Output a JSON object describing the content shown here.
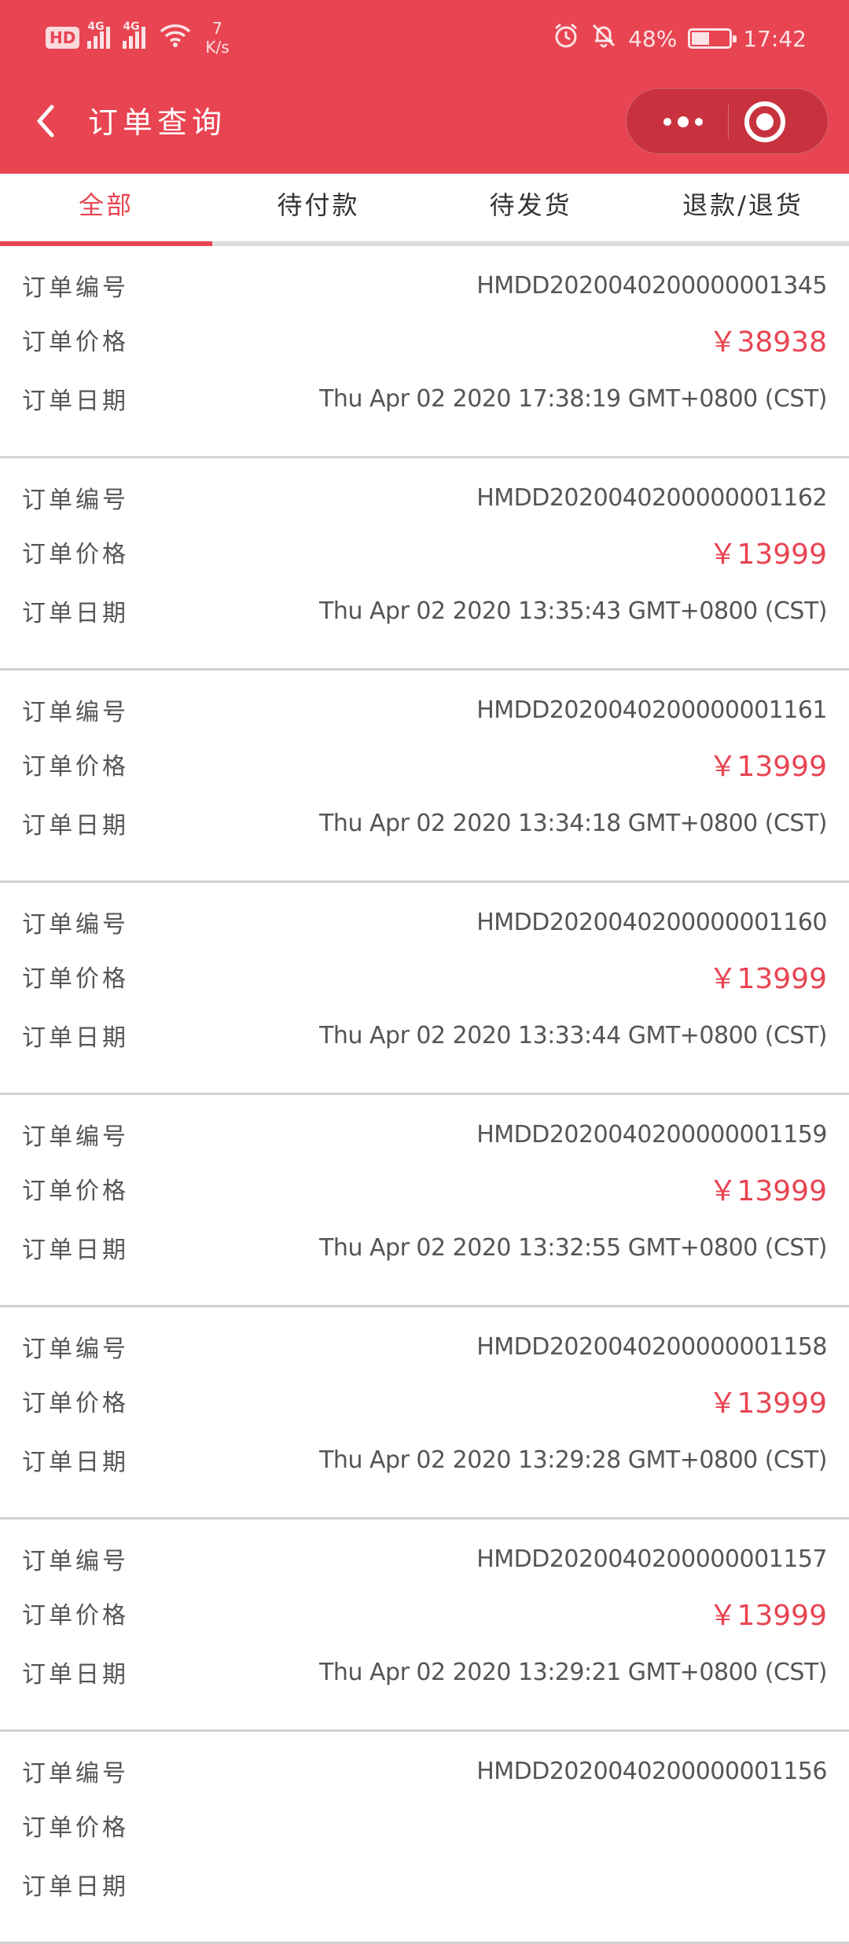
{
  "status_bar": {
    "hd": "HD",
    "net1": "4G",
    "net2": "4G",
    "speed_value": "7",
    "speed_unit": "K/s",
    "battery": "48%",
    "time": "17:42",
    "battery_level": 0.48
  },
  "nav": {
    "title": "订单查询"
  },
  "tabs": [
    {
      "label": "全部",
      "active": true
    },
    {
      "label": "待付款",
      "active": false
    },
    {
      "label": "待发货",
      "active": false
    },
    {
      "label": "退款/退货",
      "active": false
    }
  ],
  "labels": {
    "order_no": "订单编号",
    "price": "订单价格",
    "date": "订单日期"
  },
  "orders": [
    {
      "id": "HMDD2020040200000001345",
      "price": "￥38938",
      "date": "Thu Apr 02 2020 17:38:19 GMT+0800 (CST)"
    },
    {
      "id": "HMDD2020040200000001162",
      "price": "￥13999",
      "date": "Thu Apr 02 2020 13:35:43 GMT+0800 (CST)"
    },
    {
      "id": "HMDD2020040200000001161",
      "price": "￥13999",
      "date": "Thu Apr 02 2020 13:34:18 GMT+0800 (CST)"
    },
    {
      "id": "HMDD2020040200000001160",
      "price": "￥13999",
      "date": "Thu Apr 02 2020 13:33:44 GMT+0800 (CST)"
    },
    {
      "id": "HMDD2020040200000001159",
      "price": "￥13999",
      "date": "Thu Apr 02 2020 13:32:55 GMT+0800 (CST)"
    },
    {
      "id": "HMDD2020040200000001158",
      "price": "￥13999",
      "date": "Thu Apr 02 2020 13:29:28 GMT+0800 (CST)"
    },
    {
      "id": "HMDD2020040200000001157",
      "price": "￥13999",
      "date": "Thu Apr 02 2020 13:29:21 GMT+0800 (CST)"
    },
    {
      "id": "HMDD2020040200000001156",
      "price": "",
      "date": ""
    }
  ],
  "colors": {
    "brand": "#e84452",
    "tab_active": "#e84452",
    "price": "#e84452"
  }
}
